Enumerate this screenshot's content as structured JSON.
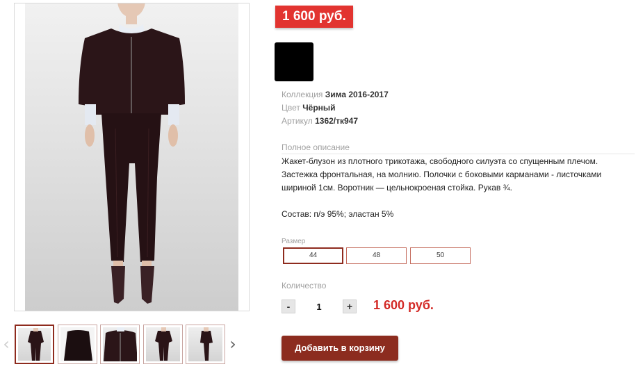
{
  "product": {
    "price_badge": "1 600 руб.",
    "color_swatch": "#000000",
    "meta": {
      "collection_label": "Коллекция",
      "collection_value": "Зима 2016-2017",
      "color_label": "Цвет",
      "color_value": "Чёрный",
      "sku_label": "Артикул",
      "sku_value": "1362/тк947"
    },
    "description_title": "Полное описание",
    "description": "Жакет-блузон из плотного трикотажа, свободного силуэта со спущенным плечом.  Застежка фронтальная, на молнию. Полочки с боковыми карманами - листочками шириной 1см. Воротник — цельнокроеная стойка. Рукав ¾.",
    "composition": "Состав: п/э 95%; эластан 5%",
    "size_title": "Размер",
    "sizes": [
      "44",
      "48",
      "50"
    ],
    "selected_size": "44",
    "quantity_title": "Количество",
    "qty_minus": "-",
    "qty_plus": "+",
    "quantity": "1",
    "total_price": "1 600 руб.",
    "add_to_cart": "Добавить в корзину"
  },
  "gallery": {
    "prev_arrow": "‹",
    "next_arrow": "›",
    "thumbnails": [
      "full-outfit-front",
      "jacket-back-dark",
      "jacket-closeup",
      "full-outfit-variant",
      "full-outfit-side"
    ],
    "active_index": 0
  },
  "colors": {
    "accent": "#e23430",
    "button": "#8c2c1f",
    "price_text": "#d32a26"
  }
}
